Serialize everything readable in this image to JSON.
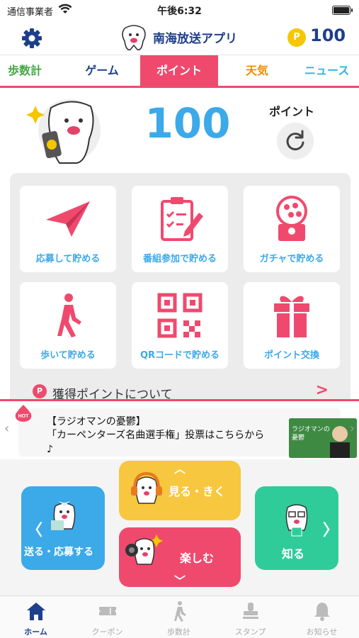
{
  "status_bar": {
    "carrier": "通信事業者",
    "time": "午後6:32"
  },
  "header": {
    "title": "南海放送アプリ",
    "coin_symbol": "P",
    "points": "100"
  },
  "tabs": [
    {
      "label": "歩数計",
      "color": "#44a844"
    },
    {
      "label": "ゲーム",
      "color": "#1e3f8a"
    },
    {
      "label": "ポイント",
      "color": "#ef4a6e",
      "selected": true
    },
    {
      "label": "天気",
      "color": "#f08d00"
    },
    {
      "label": "ニュース",
      "color": "#2fb4e9"
    }
  ],
  "point_summary": {
    "value": "100",
    "unit": "ポイント",
    "icon": "refresh-icon"
  },
  "actions": [
    {
      "label": "応募して貯める",
      "icon": "paper-plane-icon"
    },
    {
      "label": "番組参加で貯める",
      "icon": "clipboard-pen-icon"
    },
    {
      "label": "ガチャで貯める",
      "icon": "gacha-machine-icon"
    },
    {
      "label": "歩いて貯める",
      "icon": "walking-person-icon"
    },
    {
      "label": "QRコードで貯める",
      "icon": "qr-code-icon"
    },
    {
      "label": "ポイント交換",
      "icon": "gift-icon"
    }
  ],
  "about_points": {
    "icon_letter": "P",
    "label": "獲得ポイントについて",
    "chevron": ">"
  },
  "banner": {
    "badge": "HOT",
    "line1": "【ラジオマンの憂鬱】",
    "line2": "「カーペンターズ名曲選手権」投票はこちらから♪",
    "thumb_text": "ラジオマンの憂鬱"
  },
  "home_nav": {
    "listen": "見る・きく",
    "enjoy": "楽しむ",
    "send": "送る・応募する",
    "know": "知る"
  },
  "colors": {
    "accent": "#ef4a6e",
    "navy": "#1e3f8a",
    "blue": "#3ca9e8",
    "yellow": "#f7c73f",
    "green": "#2fcc99"
  },
  "bottom_nav": [
    {
      "label": "ホーム",
      "icon": "home-icon",
      "active": true
    },
    {
      "label": "クーポン",
      "icon": "ticket-icon"
    },
    {
      "label": "歩数計",
      "icon": "walking-icon"
    },
    {
      "label": "スタンプ",
      "icon": "stamp-icon"
    },
    {
      "label": "お知らせ",
      "icon": "bell-icon"
    }
  ]
}
